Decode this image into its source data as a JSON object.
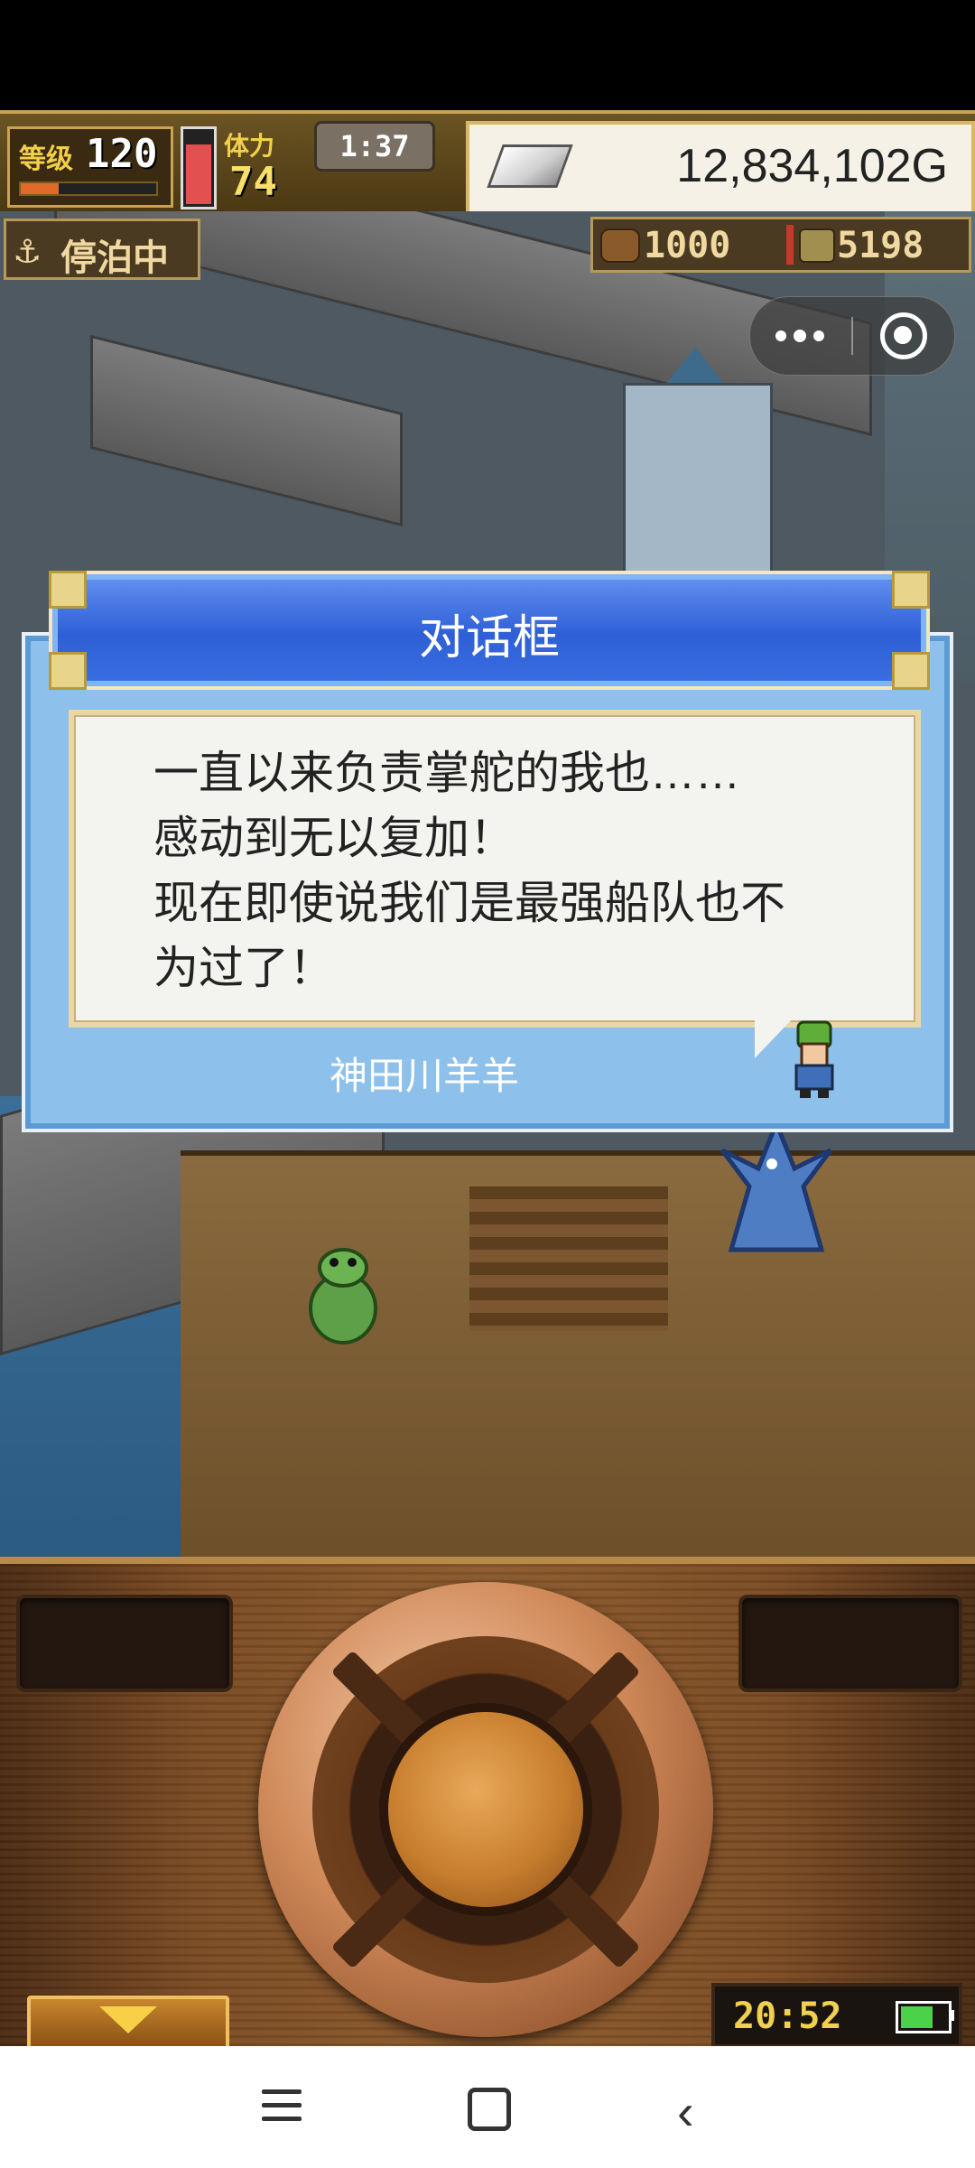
{
  "hud": {
    "level_label": "等级",
    "level_value": "120",
    "stamina_label": "体力",
    "stamina_value": "74",
    "timer": "1:37",
    "money": "12,834,102G",
    "status_label": "停泊中",
    "wood_value": "1000",
    "ore_value": "5198"
  },
  "dialog": {
    "title": "对话框",
    "lines": [
      "一直以来负责掌舵的我也……",
      "感动到无以复加！",
      "现在即使说我们是最强船队也不",
      "为过了！"
    ],
    "speaker": "神田川羊羊"
  },
  "controller": {
    "clock": "20:52"
  },
  "icons": {
    "anchor": "anchor-icon",
    "wood": "wood-icon",
    "ore": "ore-icon",
    "money": "silver-ingot-icon",
    "more": "more-dots-icon",
    "close": "target-close-icon",
    "menu_toggle": "arrow-down-icon",
    "battery": "battery-icon",
    "nav_menu": "menu-lines-icon",
    "nav_home": "square-home-icon",
    "nav_back": "chevron-left-icon"
  },
  "colors": {
    "dialog_header": "#2e5fd6",
    "dialog_frame": "#8ec0ec",
    "money_text": "#222222",
    "stamina": "#e35050"
  },
  "levels": {
    "level_progress": 0.28,
    "stamina_fill": 0.85,
    "battery_fill": 0.7
  }
}
